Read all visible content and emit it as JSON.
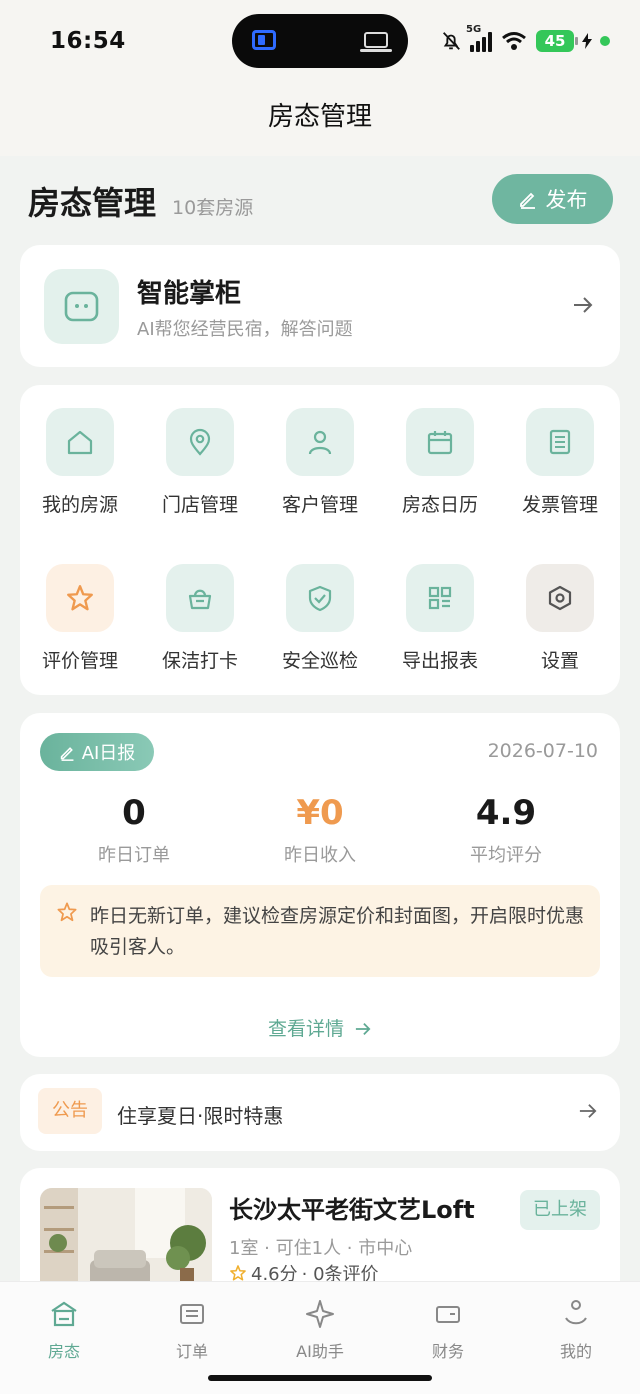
{
  "status_bar": {
    "time": "16:54",
    "network": "5G",
    "battery": "45"
  },
  "nav": {
    "title": "房态管理"
  },
  "header": {
    "title": "房态管理",
    "subtitle": "10套房源",
    "publish_label": "发布"
  },
  "assistant": {
    "title": "智能掌柜",
    "subtitle": "AI帮您经营民宿，解答问题"
  },
  "grid": {
    "items": [
      {
        "label": "我的房源",
        "icon": "home-icon"
      },
      {
        "label": "门店管理",
        "icon": "location-pin-icon"
      },
      {
        "label": "客户管理",
        "icon": "user-icon"
      },
      {
        "label": "房态日历",
        "icon": "calendar-icon"
      },
      {
        "label": "发票管理",
        "icon": "invoice-icon"
      },
      {
        "label": "评价管理",
        "icon": "star-icon"
      },
      {
        "label": "保洁打卡",
        "icon": "cleaning-basket-icon"
      },
      {
        "label": "安全巡检",
        "icon": "shield-check-icon"
      },
      {
        "label": "导出报表",
        "icon": "grid-report-icon"
      },
      {
        "label": "设置",
        "icon": "gear-hexagon-icon"
      }
    ]
  },
  "report": {
    "badge": "AI日报",
    "date": "2026-07-10",
    "stats": [
      {
        "value": "0",
        "label": "昨日订单"
      },
      {
        "value": "¥0",
        "label": "昨日收入"
      },
      {
        "value": "4.9",
        "label": "平均评分"
      }
    ],
    "tip": "昨日无新订单，建议检查房源定价和封面图，开启限时优惠吸引客人。",
    "more_label": "查看详情"
  },
  "notice": {
    "tag": "公告",
    "text": "住享夏日·限时特惠"
  },
  "listing": {
    "title": "长沙太平老街文艺Loft",
    "meta": "1室 · 可住1人 · 市中心",
    "rating": "4.6分",
    "reviews": "· 0条评价",
    "status": "已上架"
  },
  "tabbar": {
    "tabs": [
      {
        "label": "房态",
        "icon": "house-tab-icon"
      },
      {
        "label": "订单",
        "icon": "order-list-icon"
      },
      {
        "label": "AI助手",
        "icon": "sparkle-icon"
      },
      {
        "label": "财务",
        "icon": "wallet-icon"
      },
      {
        "label": "我的",
        "icon": "profile-icon"
      }
    ]
  },
  "colors": {
    "accent": "#6ab39c",
    "orange": "#ef9a4f",
    "background": "#f1f3f1"
  }
}
